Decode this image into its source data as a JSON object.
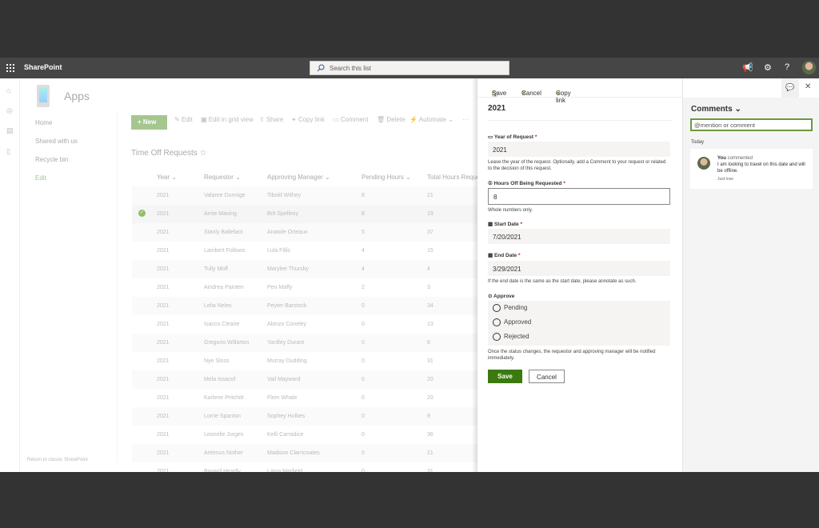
{
  "suite": {
    "brand": "SharePoint",
    "search_placeholder": "Search this list"
  },
  "site": {
    "title": "Apps"
  },
  "nav": [
    "Home",
    "Shared with us",
    "Recycle bin",
    "Edit"
  ],
  "footer_link": "Return to classic SharePoint",
  "commands": {
    "new": "New",
    "edit": "Edit",
    "grid": "Edit in grid view",
    "share": "Share",
    "copy": "Copy link",
    "comment": "Comment",
    "delete": "Delete",
    "automate": "Automate",
    "more": "···"
  },
  "list": {
    "title": "Time Off Requests",
    "columns": [
      "Year",
      "Requestor",
      "Approving Manager",
      "Pending Hours",
      "Total Hours Reque"
    ],
    "rows": [
      [
        "2021",
        "Valaree Dunnige",
        "Tibold Withey",
        "8",
        "21"
      ],
      [
        "2021",
        "Arnie Maving",
        "Brit Spellesy",
        "8",
        "19"
      ],
      [
        "2021",
        "Stanly Ballefant",
        "Anatole Orteaux",
        "5",
        "37"
      ],
      [
        "2021",
        "Lambert Follows",
        "Lula Fillis",
        "4",
        "15"
      ],
      [
        "2021",
        "Tully Moff",
        "Marylee Thursby",
        "4",
        "4"
      ],
      [
        "2021",
        "Aindrea Painten",
        "Pen Maffy",
        "2",
        "3"
      ],
      [
        "2021",
        "Lelia Neles",
        "Peyter Barstock",
        "0",
        "34"
      ],
      [
        "2021",
        "Isacco Clearie",
        "Alonzo Coneley",
        "0",
        "13"
      ],
      [
        "2021",
        "Gregorio Willarton",
        "Yardley Durant",
        "0",
        "6"
      ],
      [
        "2021",
        "Nye Sloss",
        "Murray Dudding",
        "0",
        "31"
      ],
      [
        "2021",
        "Mela Issacof",
        "Vail Mayward",
        "0",
        "20"
      ],
      [
        "2021",
        "Karlene Pritchitt",
        "Flem Whale",
        "0",
        "20"
      ],
      [
        "2021",
        "Lorrie Spanton",
        "Sophey Hulkes",
        "0",
        "9"
      ],
      [
        "2021",
        "Leonelle Jurges",
        "Kelli Carradice",
        "0",
        "36"
      ],
      [
        "2021",
        "Artemus Nother",
        "Madison Clarricoates",
        "0",
        "21"
      ],
      [
        "2021",
        "Bayard Headly",
        "Laina Marfield",
        "0",
        "31"
      ]
    ],
    "selected_row": 1
  },
  "panel": {
    "toolbar": {
      "save": "Save",
      "cancel": "Cancel",
      "copy": "Copy link"
    },
    "title": "2021",
    "year_label": "Year of Request",
    "year_value": "2021",
    "year_hint": "Leave the year of the request. Optionally, add a Comment to your request or related to the decision of this request.",
    "hours_label": "Hours Off Being Requested",
    "hours_value": "8",
    "hours_hint": "Whole numbers only.",
    "start_label": "Start Date",
    "start_value": "7/20/2021",
    "end_label": "End Date",
    "end_value": "3/29/2021",
    "end_hint": "If the end date is the same as the start date, please annotate as such.",
    "approve_label": "Approve",
    "options": [
      "Pending",
      "Approved",
      "Rejected"
    ],
    "approve_hint": "Once the status changes, the requestor and approving manager will be notified immediately.",
    "save": "Save",
    "cancel": "Cancel",
    "required": "*"
  },
  "comments": {
    "title": "Comments",
    "placeholder": "@mention or comment",
    "today": "Today",
    "author": "You",
    "action": "commented",
    "text": "I am looking to travel on this date and will be offline.",
    "time": "Just now"
  },
  "colors": {
    "accent": "#3b7a0f",
    "suite": "#464646"
  }
}
